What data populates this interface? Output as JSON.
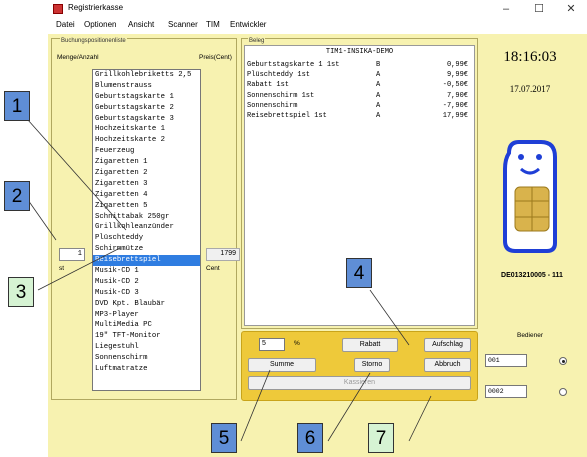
{
  "window": {
    "title": "Registrierkasse",
    "controls": [
      "–",
      "☐",
      "✕"
    ]
  },
  "menu": [
    "Datei",
    "Optionen",
    "Ansicht",
    "Scanner",
    "TIM",
    "Entwickler"
  ],
  "left_panel": {
    "title": "Buchungspositionenliste",
    "header_qty": "Menge/Anzahl",
    "header_price": "Preis(Cent)",
    "qty_value": "1",
    "qty_unit": "st",
    "price_value": "1799",
    "price_unit": "Cent",
    "products": [
      "Grillkohlebriketts 2,5",
      "Blumenstrauss",
      "Geburtstagskarte 1",
      "Geburtstagskarte 2",
      "Geburtstagskarte 3",
      "Hochzeitskarte 1",
      "Hochzeitskarte 2",
      "Feuerzeug",
      "Zigaretten 1",
      "Zigaretten 2",
      "Zigaretten 3",
      "Zigaretten 4",
      "Zigaretten 5",
      "Schnittabak 250gr",
      "Grillkohleanzünder",
      "Plüschteddy",
      "Schirmmütze",
      "Reisebrettspiel",
      "Musik-CD 1",
      "Musik-CD 2",
      "Musik-CD 3",
      "DVD Kpt. Blaubär",
      "MP3-Player",
      "MultiMedia PC",
      "19\" TFT-Monitor",
      "Liegestuhl",
      "Sonnenschirm",
      "Luftmatratze"
    ],
    "selected_index": 17
  },
  "receipt": {
    "title": "Beleg",
    "header": "TIM1-INSIKA-DEMO",
    "rows": [
      {
        "item": "Geburtstagskarte 1 1st",
        "tax": "B",
        "amount": "0,99€"
      },
      {
        "item": "Plüschteddy 1st",
        "tax": "A",
        "amount": "9,99€"
      },
      {
        "item": "Rabatt 1st",
        "tax": "A",
        "amount": "-0,50€"
      },
      {
        "item": "Sonnenschirm 1st",
        "tax": "A",
        "amount": "7,90€"
      },
      {
        "item": "Sonnenschirm",
        "tax": "A",
        "amount": "-7,90€"
      },
      {
        "item": "Reisebrettspiel 1st",
        "tax": "A",
        "amount": "17,99€"
      }
    ]
  },
  "buttons": {
    "percent_value": "5",
    "percent_label": "%",
    "rabatt": "Rabatt",
    "aufschlag": "Aufschlag",
    "summe": "Summe",
    "storno": "Storno",
    "abbruch": "Abbruch",
    "kassieren": "Kassieren"
  },
  "right_panel": {
    "time": "18:16:03",
    "date": "17.07.2017",
    "terminal_id": "DE013210005 - 111",
    "operator_label": "Bediener",
    "operators": [
      "001",
      "0002"
    ],
    "selected_operator": 0
  },
  "callouts": [
    "1",
    "2",
    "3",
    "4",
    "5",
    "6",
    "7"
  ],
  "colors": {
    "panel": "#f7f2b0",
    "button_area": "#eec93a",
    "selection": "#2f7de1",
    "card_outline": "#1f3fd6"
  }
}
